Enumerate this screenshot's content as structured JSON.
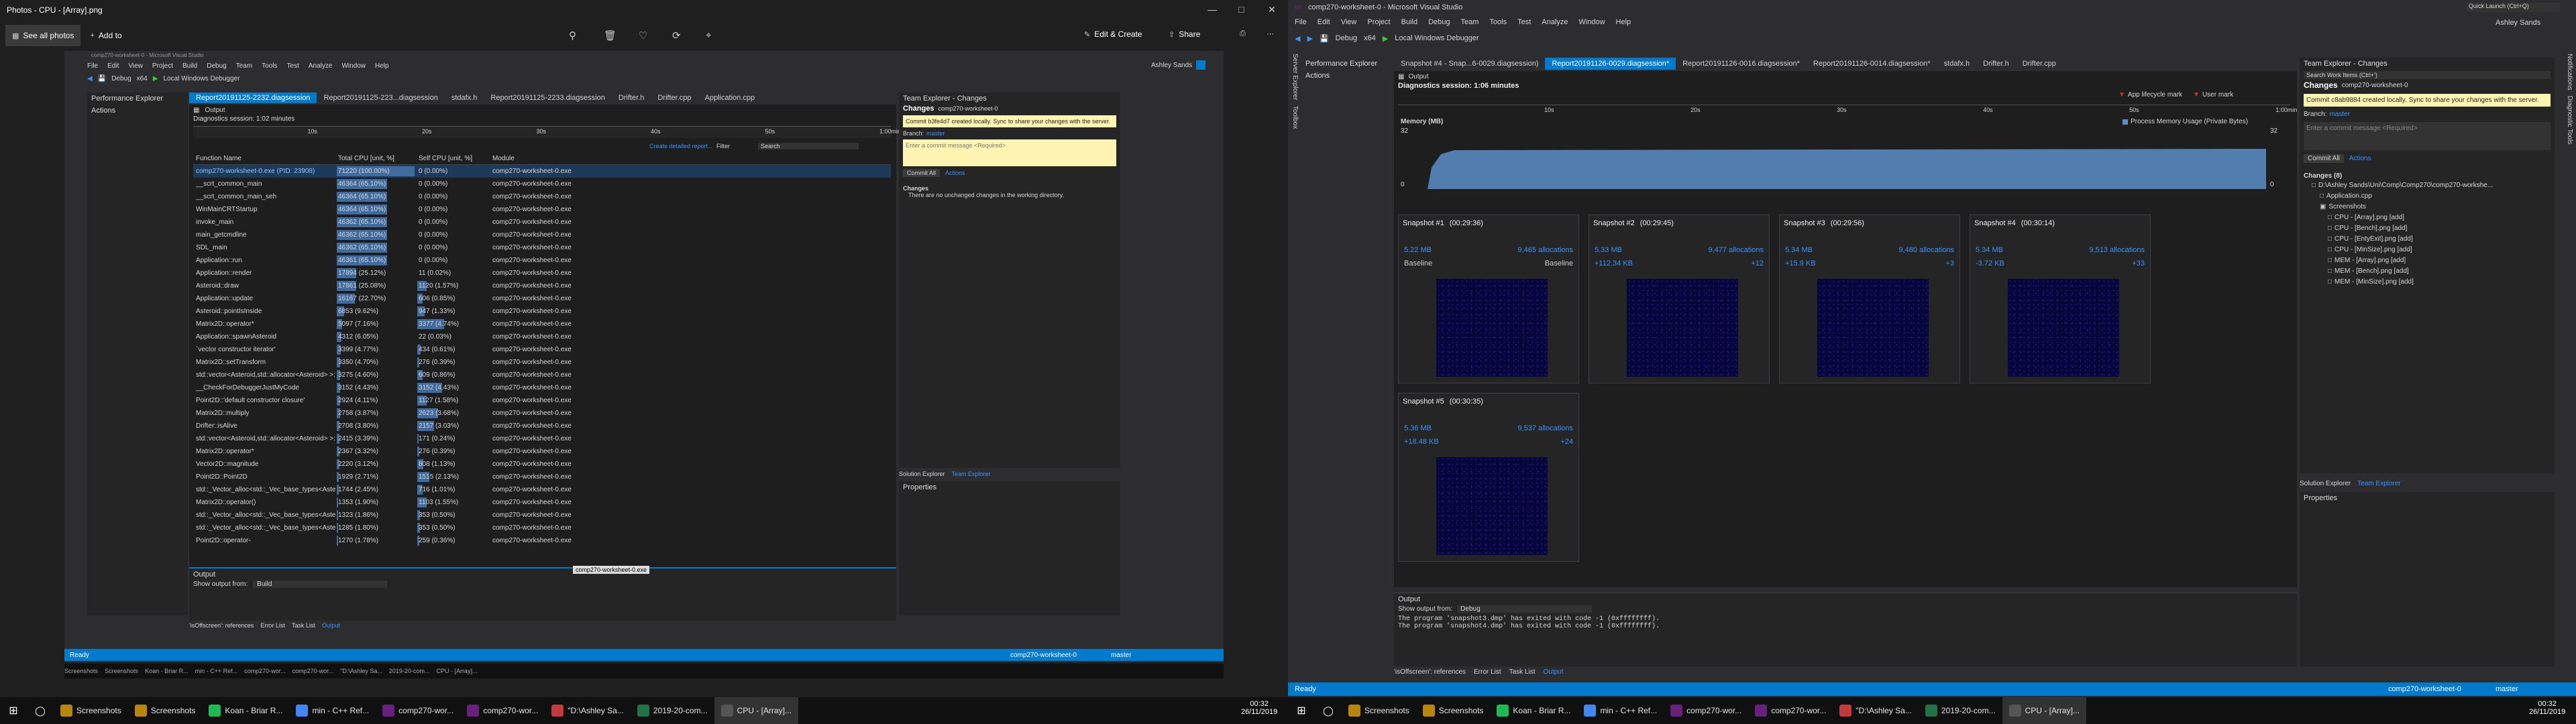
{
  "left": {
    "photos": {
      "title": "Photos - CPU - [Array].png",
      "see_all": "See all photos",
      "add_to": "Add to",
      "edit_create": "Edit & Create",
      "share": "Share"
    },
    "vs": {
      "title": "comp270-worksheet-0 - Microsoft Visual Studio",
      "menu": [
        "File",
        "Edit",
        "View",
        "Project",
        "Build",
        "Debug",
        "Team",
        "Tools",
        "Test",
        "Analyze",
        "Window",
        "Help"
      ],
      "debug": "Debug",
      "platform": "x64",
      "run": "Local Windows Debugger",
      "user": "Ashley Sands",
      "perf_explorer": "Performance Explorer",
      "actions": "Actions",
      "doc_tabs": [
        "Report20191125-2232.diagsession",
        "Report20191125-223...diagsession",
        "stdafx.h",
        "Report20191125-2233.diagsession",
        "Drifter.h",
        "Drifter.cpp",
        "Application.cpp"
      ],
      "output_btn": "Output",
      "session": "Diagnostics session: 1:02 minutes",
      "ruler": [
        "10s",
        "20s",
        "30s",
        "40s",
        "50s",
        "1:00min"
      ],
      "create_report": "Create detailed report...",
      "filter": "Filter",
      "search_ph": "Search",
      "columns": [
        "Function Name",
        "Total CPU [unit, %]",
        "Self CPU [unit, %]",
        "Module"
      ],
      "rows": [
        {
          "name": "comp270-worksheet-0.exe (PID: 23908)",
          "total": "71220 (100.00%)",
          "self": "0 (0.00%)",
          "module": "comp270-worksheet-0.exe",
          "tp": 100,
          "sp": 0
        },
        {
          "name": "__scrt_common_main",
          "total": "46364 (65.10%)",
          "self": "0 (0.00%)",
          "module": "comp270-worksheet-0.exe",
          "tp": 65,
          "sp": 0
        },
        {
          "name": "__scrt_common_main_seh",
          "total": "46364 (65.10%)",
          "self": "0 (0.00%)",
          "module": "comp270-worksheet-0.exe",
          "tp": 65,
          "sp": 0
        },
        {
          "name": "WinMainCRTStartup",
          "total": "46364 (65.10%)",
          "self": "0 (0.00%)",
          "module": "comp270-worksheet-0.exe",
          "tp": 65,
          "sp": 0
        },
        {
          "name": "invoke_main",
          "total": "46362 (65.10%)",
          "self": "0 (0.00%)",
          "module": "comp270-worksheet-0.exe",
          "tp": 65,
          "sp": 0
        },
        {
          "name": "main_getcmdline",
          "total": "46362 (65.10%)",
          "self": "0 (0.00%)",
          "module": "comp270-worksheet-0.exe",
          "tp": 65,
          "sp": 0
        },
        {
          "name": "SDL_main",
          "total": "46362 (65.10%)",
          "self": "0 (0.00%)",
          "module": "comp270-worksheet-0.exe",
          "tp": 65,
          "sp": 0
        },
        {
          "name": "Application::run",
          "total": "46361 (65.10%)",
          "self": "0 (0.00%)",
          "module": "comp270-worksheet-0.exe",
          "tp": 65,
          "sp": 0
        },
        {
          "name": "Application::render",
          "total": "17894 (25.12%)",
          "self": "11 (0.02%)",
          "module": "comp270-worksheet-0.exe",
          "tp": 25,
          "sp": 0
        },
        {
          "name": "Asteroid::draw",
          "total": "17861 (25.08%)",
          "self": "1120 (1.57%)",
          "module": "comp270-worksheet-0.exe",
          "tp": 25,
          "sp": 1.6
        },
        {
          "name": "Application::update",
          "total": "16167 (22.70%)",
          "self": "606 (0.85%)",
          "module": "comp270-worksheet-0.exe",
          "tp": 23,
          "sp": 0.9
        },
        {
          "name": "Asteroid::pointIsInside",
          "total": "6853 (9.62%)",
          "self": "947 (1.33%)",
          "module": "comp270-worksheet-0.exe",
          "tp": 9.6,
          "sp": 1.3
        },
        {
          "name": "Matrix2D::operator*",
          "total": "5097 (7.16%)",
          "self": "3377 (4.74%)",
          "module": "comp270-worksheet-0.exe",
          "tp": 7.2,
          "sp": 4.7
        },
        {
          "name": "Application::spawnAsteroid",
          "total": "4312 (6.05%)",
          "self": "22 (0.03%)",
          "module": "comp270-worksheet-0.exe",
          "tp": 6,
          "sp": 0
        },
        {
          "name": "`vector constructor iterator'",
          "total": "3399 (4.77%)",
          "self": "434 (0.61%)",
          "module": "comp270-worksheet-0.exe",
          "tp": 4.8,
          "sp": 0.6
        },
        {
          "name": "Matrix2D::setTransform",
          "total": "3350 (4.70%)",
          "self": "276 (0.39%)",
          "module": "comp270-worksheet-0.exe",
          "tp": 4.7,
          "sp": 0.4
        },
        {
          "name": "std::vector<Asteroid,std::allocator<Asteroid> >::e...",
          "total": "3275 (4.60%)",
          "self": "609 (0.86%)",
          "module": "comp270-worksheet-0.exe",
          "tp": 4.6,
          "sp": 0.9
        },
        {
          "name": "__CheckForDebuggerJustMyCode",
          "total": "3152 (4.43%)",
          "self": "3152 (4.43%)",
          "module": "comp270-worksheet-0.exe",
          "tp": 4.4,
          "sp": 4.4
        },
        {
          "name": "Point2D::'default constructor closure'",
          "total": "2924 (4.11%)",
          "self": "1127 (1.58%)",
          "module": "comp270-worksheet-0.exe",
          "tp": 4.1,
          "sp": 1.6
        },
        {
          "name": "Matrix2D::multiply",
          "total": "2758 (3.87%)",
          "self": "2623 (3.68%)",
          "module": "comp270-worksheet-0.exe",
          "tp": 3.9,
          "sp": 3.7
        },
        {
          "name": "Drifter::isAlive",
          "total": "2708 (3.80%)",
          "self": "2157 (3.03%)",
          "module": "comp270-worksheet-0.exe",
          "tp": 3.8,
          "sp": 3
        },
        {
          "name": "std::vector<Asteroid,std::allocator<Asteroid> >::o...",
          "total": "2415 (3.39%)",
          "self": "171 (0.24%)",
          "module": "comp270-worksheet-0.exe",
          "tp": 3.4,
          "sp": 0.2
        },
        {
          "name": "Matrix2D::operator*",
          "total": "2367 (3.32%)",
          "self": "276 (0.39%)",
          "module": "comp270-worksheet-0.exe",
          "tp": 3.3,
          "sp": 0.4
        },
        {
          "name": "Vector2D::magnitude",
          "total": "2220 (3.12%)",
          "self": "808 (1.13%)",
          "module": "comp270-worksheet-0.exe",
          "tp": 3.1,
          "sp": 1.1
        },
        {
          "name": "Point2D::Point2D",
          "total": "1929 (2.71%)",
          "self": "1515 (2.13%)",
          "module": "comp270-worksheet-0.exe",
          "tp": 2.7,
          "sp": 2.1
        },
        {
          "name": "std::_Vector_alloc<std::_Vec_base_types<Asteroid...",
          "total": "1744 (2.45%)",
          "self": "716 (1.01%)",
          "module": "comp270-worksheet-0.exe",
          "tp": 2.5,
          "sp": 1
        },
        {
          "name": "Matrix2D::operator()",
          "total": "1353 (1.90%)",
          "self": "1103 (1.55%)",
          "module": "comp270-worksheet-0.exe",
          "tp": 1.9,
          "sp": 1.6
        },
        {
          "name": "std::_Vector_alloc<std::_Vec_base_types<Asteroid...",
          "total": "1323 (1.86%)",
          "self": "353 (0.50%)",
          "module": "comp270-worksheet-0.exe",
          "tp": 1.9,
          "sp": 0.5
        },
        {
          "name": "std::_Vector_alloc<std::_Vec_base_types<Asteroid...",
          "total": "1285 (1.80%)",
          "self": "353 (0.50%)",
          "module": "comp270-worksheet-0.exe",
          "tp": 1.8,
          "sp": 0.5
        },
        {
          "name": "Point2D::operator-",
          "total": "1270 (1.78%)",
          "self": "259 (0.36%)",
          "module": "comp270-worksheet-0.exe",
          "tp": 1.8,
          "sp": 0.4
        }
      ],
      "team_explorer": "Team Explorer - Changes",
      "changes": "Changes",
      "repo": "comp270-worksheet-0",
      "commit_msg": "Commit b3fe4d7 created locally. Sync to share your changes with the server.",
      "branch_label": "Branch:",
      "branch": "master",
      "commit_ph": "Enter a commit message <Required>",
      "commit_all": "Commit All",
      "no_changes": "There are no unchanged changes in the working directory.",
      "sol_tab": "Solution Explorer",
      "team_tab": "Team Explorer",
      "properties": "Properties",
      "output_title": "Output",
      "show_from": "Show output from:",
      "show_from_val": "Build",
      "tooltip": "comp270-worksheet-0.exe",
      "bottom_tabs": [
        "'isOffscreen': references",
        "Error List",
        "Task List",
        "Output"
      ],
      "status_ready": "Ready",
      "status_repo": "comp270-worksheet-0",
      "status_branch": "master"
    },
    "taskbar": {
      "items": [
        "Screenshots",
        "Screenshots",
        "Koan - Briar R...",
        "min - C++ Ref...",
        "comp270-wor...",
        "comp270-wor...",
        "\"D:\\Ashley Sa...",
        "2019-20-com...",
        "CPU - [Array]..."
      ],
      "time": "00:32",
      "date": "26/11/2019"
    }
  },
  "right": {
    "title": "comp270-worksheet-0 - Microsoft Visual Studio",
    "menu": [
      "File",
      "Edit",
      "View",
      "Project",
      "Build",
      "Debug",
      "Team",
      "Tools",
      "Test",
      "Analyze",
      "Window",
      "Help"
    ],
    "quick_launch": "Quick Launch (Ctrl+Q)",
    "user": "Ashley Sands",
    "debug": "Debug",
    "platform": "x64",
    "run": "Local Windows Debugger",
    "perf_explorer": "Performance Explorer",
    "actions": "Actions",
    "doc_tabs": [
      "Snapshot #4 - Snap...6-0029.diagsession)",
      "Report20191126-0029.diagsession*",
      "Report20191126-0016.diagsession*",
      "Report20191126-0014.diagsession*",
      "stdafx.h",
      "Drifter.h",
      "Drifter.cpp"
    ],
    "output_btn": "Output",
    "session": "Diagnostics session: 1:06 minutes",
    "app_marker": "App lifecycle mark",
    "user_marker": "User mark",
    "ruler": [
      "10s",
      "20s",
      "30s",
      "40s",
      "50s",
      "1:00min"
    ],
    "memory_title": "Memory (MB)",
    "memory_legend": "Process Memory Usage (Private Bytes)",
    "mem_max": "32",
    "mem_min": "0",
    "snapshots": [
      {
        "title": "Snapshot #1",
        "time": "(00:29:36)",
        "size": "5.22 MB",
        "alloc": "9,465 allocations",
        "sdiff": "Baseline",
        "adiff": "Baseline"
      },
      {
        "title": "Snapshot #2",
        "time": "(00:29:45)",
        "size": "5.33 MB",
        "alloc": "9,477 allocations",
        "sdiff": "+112.34 KB",
        "adiff": "+12"
      },
      {
        "title": "Snapshot #3",
        "time": "(00:29:56)",
        "size": "5.34 MB",
        "alloc": "9,480 allocations",
        "sdiff": "+15.9 KB",
        "adiff": "+3"
      },
      {
        "title": "Snapshot #4",
        "time": "(00:30:14)",
        "size": "5.34 MB",
        "alloc": "9,513 allocations",
        "sdiff": "-3.72 KB",
        "adiff": "+33"
      },
      {
        "title": "Snapshot #5",
        "time": "(00:30:35)",
        "size": "5.36 MB",
        "alloc": "9,537 allocations",
        "sdiff": "+18.48 KB",
        "adiff": "+24"
      }
    ],
    "output_title": "Output",
    "show_from": "Show output from:",
    "show_from_val": "Debug",
    "output_lines": [
      "The program 'snapshot3.dmp' has exited with code -1 (0xffffffff).",
      "The program 'snapshot4.dmp' has exited with code -1 (0xffffffff)."
    ],
    "bottom_tabs": [
      "'isOffscreen': references",
      "Error List",
      "Task List",
      "Output"
    ],
    "team_explorer": "Team Explorer - Changes",
    "search_ph": "Search Work Items (Ctrl+')",
    "changes": "Changes",
    "repo": "comp270-worksheet-0",
    "commit_msg": "Commit c8ab9884 created locally. Sync to share your changes with the server.",
    "branch_label": "Branch:",
    "branch": "master",
    "commit_ph": "Enter a commit message <Required>",
    "commit_all": "Commit All",
    "changes_count": "Changes (8)",
    "tree": [
      {
        "label": "D:\\Ashley Sands\\Uni\\Comp\\Comp270\\comp270-workshe...",
        "indent": 1
      },
      {
        "label": "Application.cpp",
        "indent": 2
      },
      {
        "label": "Screenshots",
        "indent": 2
      },
      {
        "label": "CPU - [Array].png [add]",
        "indent": 3
      },
      {
        "label": "CPU - [Bench].png [add]",
        "indent": 3
      },
      {
        "label": "CPU - [EntyExit].png [add]",
        "indent": 3
      },
      {
        "label": "CPU - [MinSize].png [add]",
        "indent": 3
      },
      {
        "label": "MEM - [Array].png [add]",
        "indent": 3
      },
      {
        "label": "MEM - [Bench].png [add]",
        "indent": 3
      },
      {
        "label": "MEM - [MinSize].png [add]",
        "indent": 3
      }
    ],
    "sol_tab": "Solution Explorer",
    "team_tab": "Team Explorer",
    "properties": "Properties",
    "status_ready": "Ready",
    "status_repo": "comp270-worksheet-0",
    "status_branch": "master",
    "taskbar": {
      "items": [
        "Screenshots",
        "Screenshots",
        "Koan - Briar R...",
        "min - C++ Ref...",
        "comp270-wor...",
        "comp270-wor...",
        "\"D:\\Ashley Sa...",
        "2019-20-com...",
        "CPU - [Array]..."
      ],
      "time": "00:32",
      "date": "26/11/2019"
    }
  },
  "colors": {
    "accent": "#007acc",
    "bar": "#3f6b9e",
    "changes_bg": "#fff4b2"
  }
}
